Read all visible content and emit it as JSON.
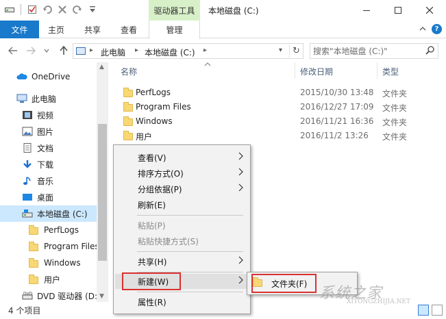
{
  "window": {
    "title": "本地磁盘 (C:)",
    "context_tab": "驱动器工具",
    "controls": [
      "minimize",
      "maximize",
      "close"
    ]
  },
  "quick_access": {
    "icons": [
      "drive-icon",
      "properties-check-icon",
      "undo-curved-icon",
      "delete-x-icon",
      "redo-icon",
      "customize-dropdown-icon"
    ]
  },
  "ribbon": {
    "tabs": [
      "文件",
      "主页",
      "共享",
      "查看",
      "管理"
    ],
    "accent": "#1979ca",
    "context_accent": "#d8f0c8"
  },
  "address": {
    "crumbs": [
      "此电脑",
      "本地磁盘 (C:)"
    ],
    "search_placeholder": "搜索\"本地磁盘 (C:)\""
  },
  "nav": {
    "items": [
      {
        "label": "OneDrive",
        "icon": "cloud-icon"
      },
      {
        "label": "此电脑",
        "icon": "computer-icon"
      },
      {
        "label": "视频",
        "icon": "video-icon"
      },
      {
        "label": "图片",
        "icon": "picture-icon"
      },
      {
        "label": "文档",
        "icon": "document-icon"
      },
      {
        "label": "下载",
        "icon": "download-icon"
      },
      {
        "label": "音乐",
        "icon": "music-icon"
      },
      {
        "label": "桌面",
        "icon": "desktop-icon"
      },
      {
        "label": "本地磁盘 (C:)",
        "icon": "drive-icon",
        "selected": true
      },
      {
        "label": "PerfLogs",
        "icon": "folder-icon"
      },
      {
        "label": "Program Files",
        "icon": "folder-icon"
      },
      {
        "label": "Windows",
        "icon": "folder-icon"
      },
      {
        "label": "用户",
        "icon": "folder-icon"
      },
      {
        "label": "DVD 驱动器 (D:",
        "icon": "dvd-icon"
      }
    ]
  },
  "columns": {
    "name": "名称",
    "date": "修改日期",
    "type": "类型"
  },
  "files": [
    {
      "name": "PerfLogs",
      "date": "2015/10/30 13:48",
      "type": "文件夹"
    },
    {
      "name": "Program Files",
      "date": "2016/12/27 17:09",
      "type": "文件夹"
    },
    {
      "name": "Windows",
      "date": "2016/11/21 16:36",
      "type": "文件夹"
    },
    {
      "name": "用户",
      "date": "2016/11/2 13:26",
      "type": "文件夹"
    }
  ],
  "status": {
    "count": "4 个项目"
  },
  "context_menu": {
    "items": [
      {
        "label": "查看(V)",
        "submenu": true
      },
      {
        "label": "排序方式(O)",
        "submenu": true
      },
      {
        "label": "分组依据(P)",
        "submenu": true
      },
      {
        "label": "刷新(E)"
      },
      {
        "label": "粘贴(P)",
        "disabled": true
      },
      {
        "label": "粘贴快捷方式(S)",
        "disabled": true
      },
      {
        "label": "共享(H)",
        "submenu": true
      },
      {
        "label": "新建(W)",
        "submenu": true,
        "highlighted": true
      },
      {
        "label": "属性(R)"
      }
    ],
    "highlight_color": "#d93030"
  },
  "submenu": {
    "items": [
      {
        "label": "文件夹(F)",
        "icon": "folder-icon"
      }
    ]
  },
  "watermark": {
    "text": "系统之家",
    "sub": "XITONGZHIJIA.NET"
  }
}
